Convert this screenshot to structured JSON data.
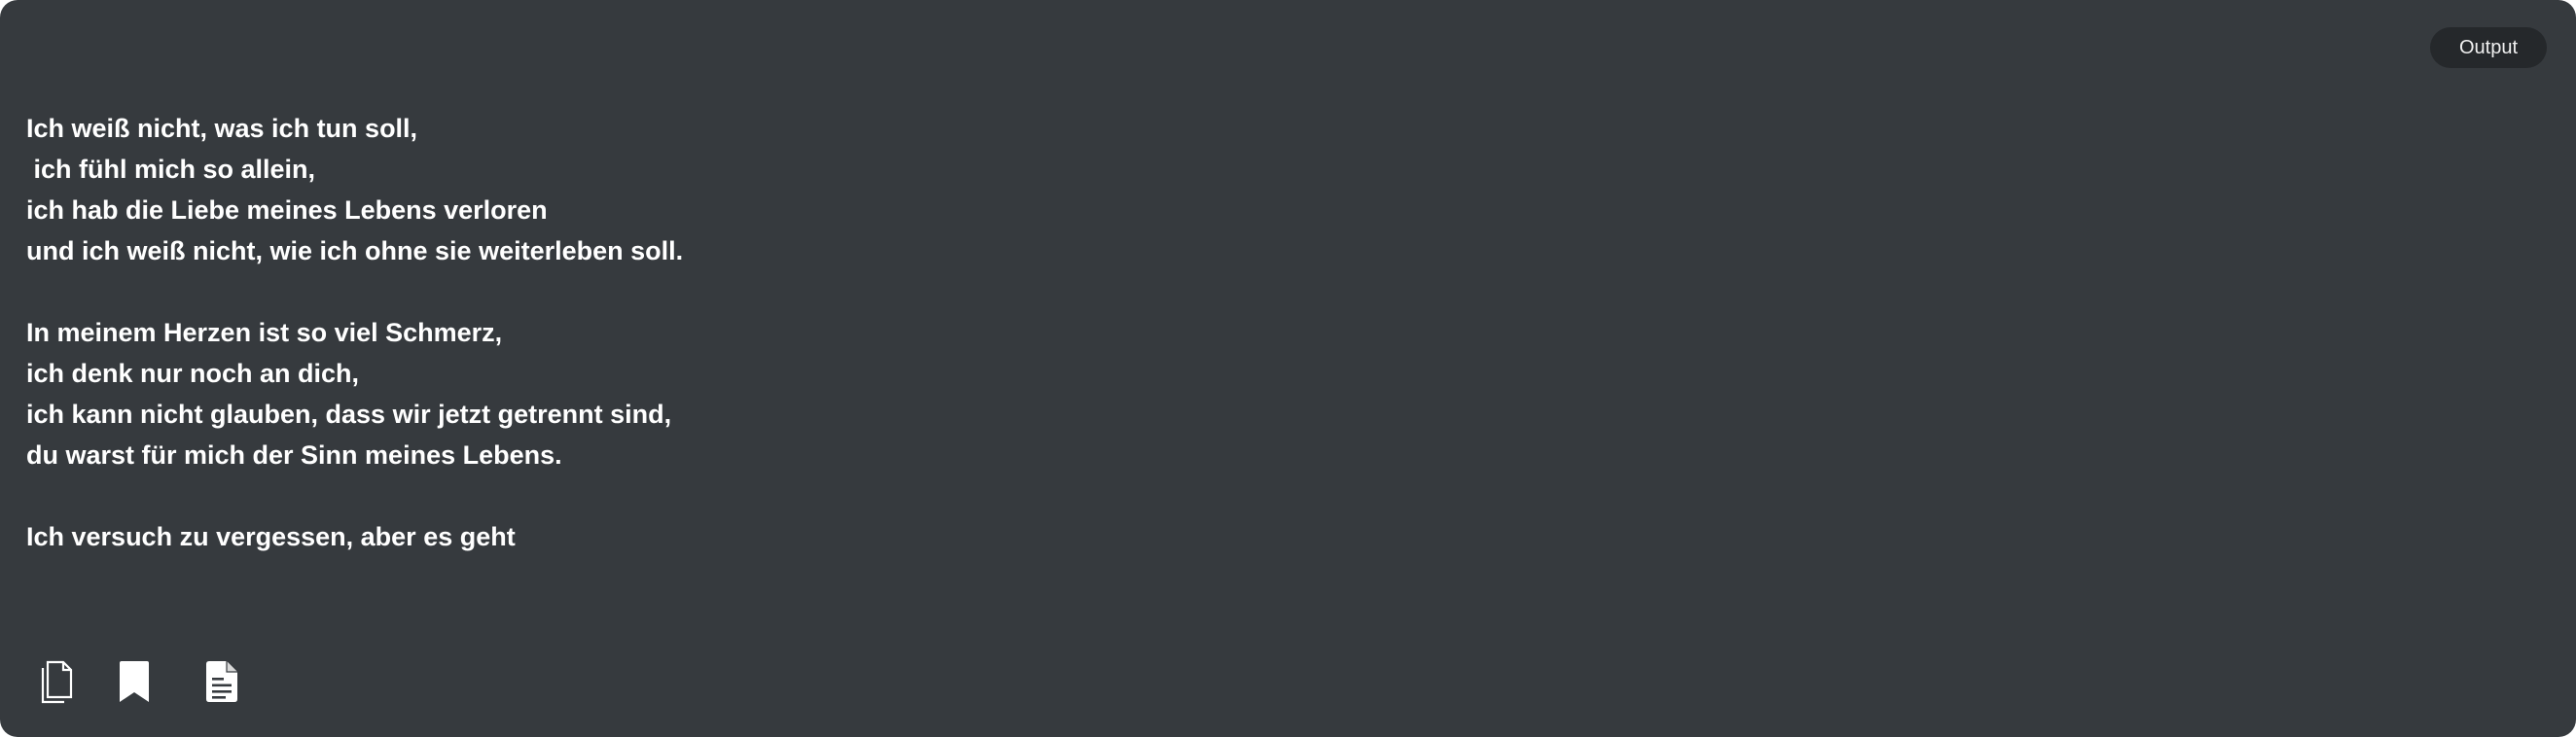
{
  "header": {
    "badge_label": "Output"
  },
  "poem": {
    "stanzas": [
      {
        "lines": [
          "Ich weiß nicht, was ich tun soll,",
          " ich fühl mich so allein,",
          "ich hab die Liebe meines Lebens verloren",
          "und ich weiß nicht, wie ich ohne sie weiterleben soll."
        ]
      },
      {
        "lines": [
          "In meinem Herzen ist so viel Schmerz,",
          "ich denk nur noch an dich,",
          "ich kann nicht glauben, dass wir jetzt getrennt sind,",
          "du warst für mich der Sinn meines Lebens."
        ]
      },
      {
        "lines": [
          "Ich versuch zu vergessen, aber es geht"
        ]
      }
    ]
  },
  "toolbar": {
    "icons": [
      "copy-icon",
      "bookmark-icon",
      "document-icon"
    ]
  },
  "colors": {
    "panel_background": "#363a3e",
    "badge_background": "#25282b",
    "text": "#ffffff"
  }
}
